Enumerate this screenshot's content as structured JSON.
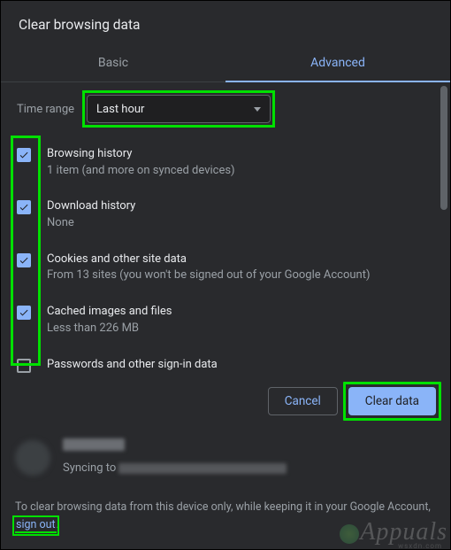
{
  "dialog": {
    "title": "Clear browsing data",
    "tabs": {
      "basic": "Basic",
      "advanced": "Advanced",
      "active": "advanced"
    },
    "time_range": {
      "label": "Time range",
      "value": "Last hour"
    },
    "items": [
      {
        "checked": true,
        "title": "Browsing history",
        "sub": "1 item (and more on synced devices)"
      },
      {
        "checked": true,
        "title": "Download history",
        "sub": "None"
      },
      {
        "checked": true,
        "title": "Cookies and other site data",
        "sub": "From 13 sites (you won't be signed out of your Google Account)"
      },
      {
        "checked": true,
        "title": "Cached images and files",
        "sub": "Less than 226 MB"
      },
      {
        "checked": false,
        "title": "Passwords and other sign-in data",
        "sub": ""
      }
    ],
    "buttons": {
      "cancel": "Cancel",
      "clear": "Clear data"
    }
  },
  "sync": {
    "syncing_prefix": "Syncing to "
  },
  "footer": {
    "text_before": "To clear browsing data from this device only, while keeping it in your Google Account, ",
    "link": "sign out",
    "text_after": "."
  },
  "watermark": "Appuals",
  "subwatermark": "wsxdn.com"
}
